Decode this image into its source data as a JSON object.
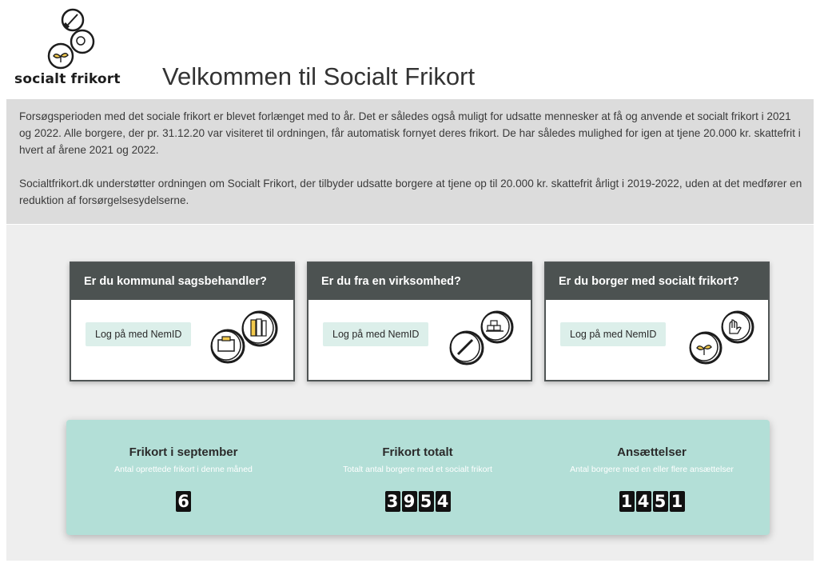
{
  "header": {
    "logo_text": "socialt frikort",
    "title": "Velkommen til Socialt Frikort"
  },
  "intro": {
    "paragraph1": "Forsøgsperioden med det sociale frikort er blevet forlænget med to år. Det er således også muligt for udsatte mennesker at få og anvende et socialt frikort i 2021 og 2022. Alle borgere, der pr. 31.12.20 var visiteret til ordningen, får automatisk fornyet deres frikort. De har således mulighed for igen at tjene 20.000 kr. skattefrit i hvert af årene 2021 og 2022.",
    "paragraph2": "Socialtfrikort.dk understøtter ordningen om Socialt Frikort, der tilbyder udsatte borgere at tjene op til 20.000 kr. skattefrit årligt i 2019-2022, uden at det medfører en reduktion af forsørgelsesydelserne."
  },
  "cards": [
    {
      "title": "Er du kommunal sagsbehandler?",
      "button": "Log på med NemID",
      "icons": [
        "folders-icon",
        "suitcase-icon"
      ]
    },
    {
      "title": "Er du fra en virksomhed?",
      "button": "Log på med NemID",
      "icons": [
        "boxes-cart-icon",
        "squeegee-icon"
      ]
    },
    {
      "title": "Er du borger med socialt frikort?",
      "button": "Log på med NemID",
      "icons": [
        "gloves-icon",
        "sprout-icon"
      ]
    }
  ],
  "stats": [
    {
      "title": "Frikort i september",
      "subtitle": "Antal oprettede frikort i denne måned",
      "value": "6"
    },
    {
      "title": "Frikort totalt",
      "subtitle": "Totalt antal borgere med et socialt frikort",
      "value": "3954"
    },
    {
      "title": "Ansættelser",
      "subtitle": "Antal borgere med en eller flere ansættelser",
      "value": "1451"
    }
  ],
  "colors": {
    "intro_bg": "#dcdcdc",
    "main_bg": "#eeeeee",
    "card_header": "#4c5251",
    "button_bg": "#dcefea",
    "stats_bg": "#b3dfd7",
    "digit_bg": "#111111"
  }
}
